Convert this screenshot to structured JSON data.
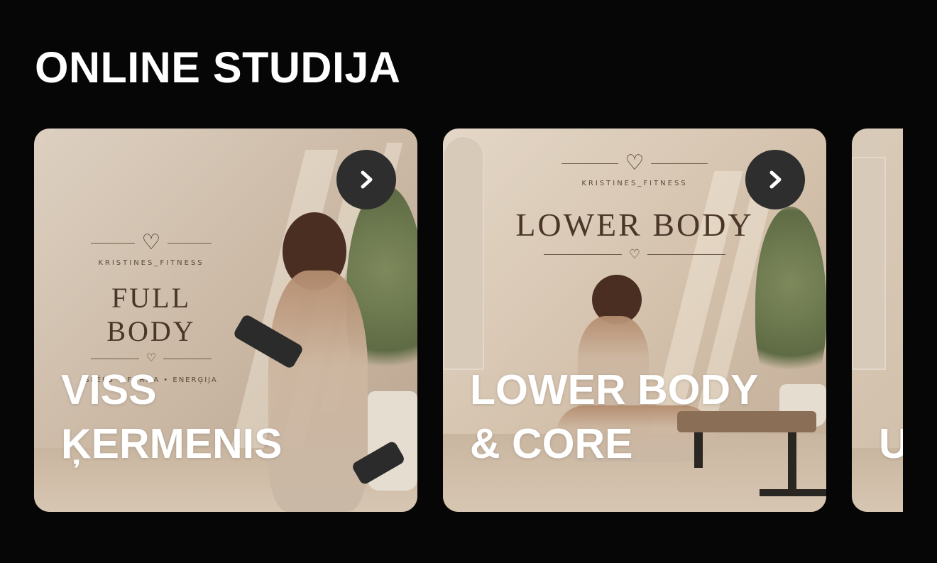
{
  "section": {
    "title": "ONLINE STUDIJA"
  },
  "cards": [
    {
      "label_line1": "VISS",
      "label_line2": "ĶERMENIS",
      "image": {
        "brand": "KRISTINES_FITNESS",
        "title": "FULL BODY",
        "tagline": "SPĒKS • FORMA • ENERĢIJA"
      },
      "button_icon": "chevron-right-icon"
    },
    {
      "label_line1": "LOWER BODY",
      "label_line2": "& CORE",
      "image": {
        "brand": "KRISTINES_FITNESS",
        "title": "LOWER BODY"
      },
      "button_icon": "chevron-right-icon"
    },
    {
      "label_line1": "",
      "label_line2": "U"
    }
  ],
  "colors": {
    "background": "#060606",
    "title": "#ffffff",
    "button_bg": "#2e2e2e",
    "card_tint": "#cdbba8"
  }
}
